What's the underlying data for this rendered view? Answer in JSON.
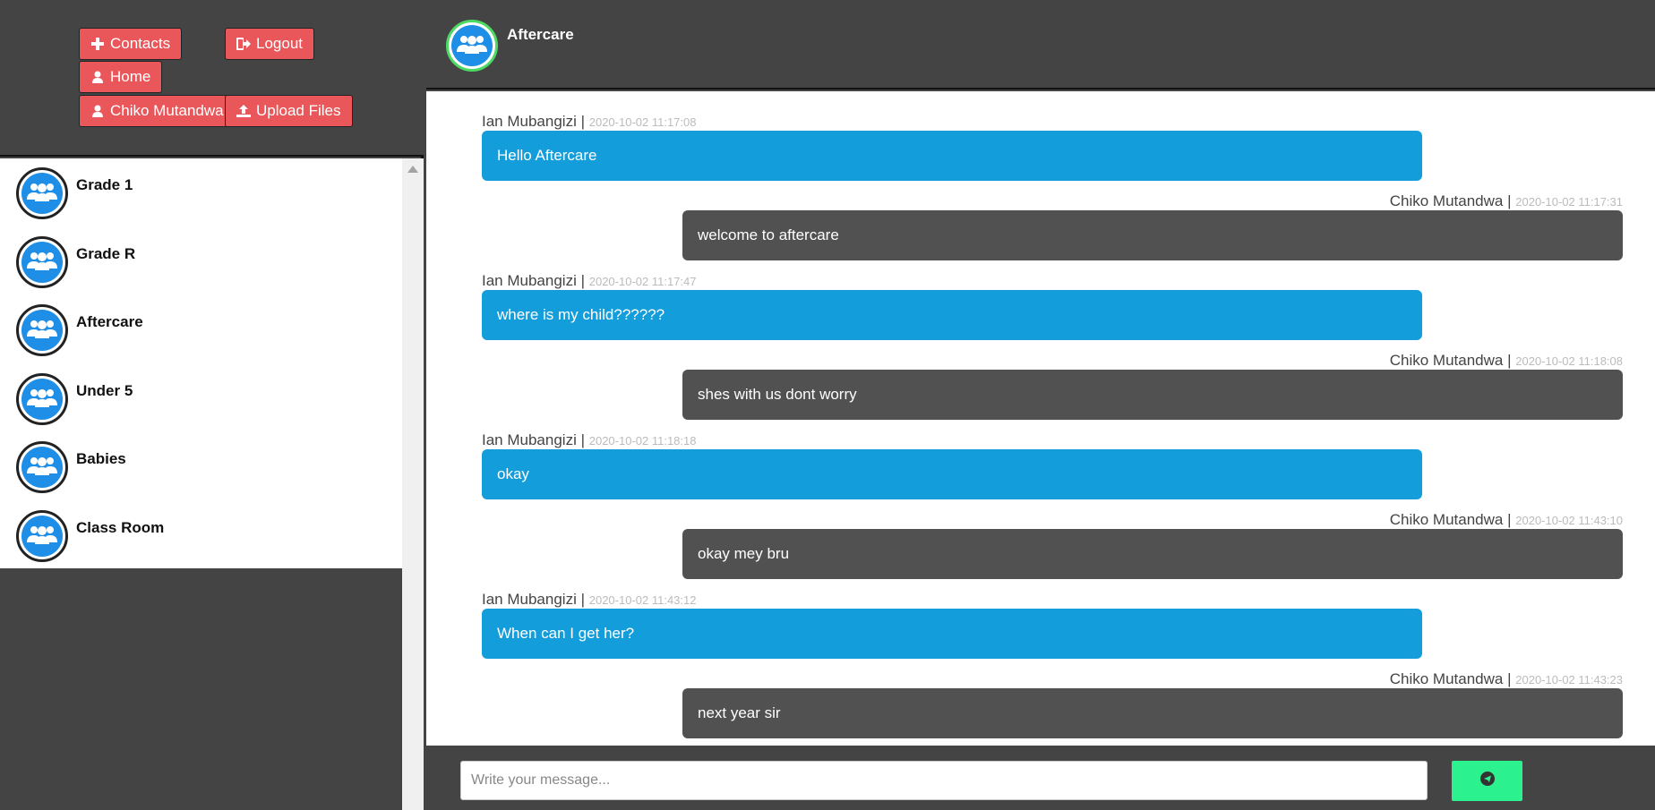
{
  "nav": {
    "contacts_label": "Contacts",
    "logout_label": "Logout",
    "home_label": "Home",
    "user_label": "Chiko Mutandwa",
    "upload_label": "Upload Files"
  },
  "contacts": [
    {
      "name": "Grade 1"
    },
    {
      "name": "Grade R"
    },
    {
      "name": "Aftercare"
    },
    {
      "name": "Under 5"
    },
    {
      "name": "Babies"
    },
    {
      "name": "Class Room"
    }
  ],
  "chat": {
    "title": "Aftercare",
    "messages": [
      {
        "sender": "Ian Mubangizi",
        "sep": "|",
        "time": "2020-10-02 11:17:08",
        "text": "Hello Aftercare",
        "direction": "in"
      },
      {
        "sender": "Chiko Mutandwa",
        "sep": "|",
        "time": "2020-10-02 11:17:31",
        "text": "welcome to aftercare",
        "direction": "out"
      },
      {
        "sender": "Ian Mubangizi",
        "sep": "|",
        "time": "2020-10-02 11:17:47",
        "text": "where is my child??????",
        "direction": "in"
      },
      {
        "sender": "Chiko Mutandwa",
        "sep": "|",
        "time": "2020-10-02 11:18:08",
        "text": "shes with us dont worry",
        "direction": "out"
      },
      {
        "sender": "Ian Mubangizi",
        "sep": "|",
        "time": "2020-10-02 11:18:18",
        "text": "okay",
        "direction": "in"
      },
      {
        "sender": "Chiko Mutandwa",
        "sep": "|",
        "time": "2020-10-02 11:43:10",
        "text": "okay mey bru",
        "direction": "out"
      },
      {
        "sender": "Ian Mubangizi",
        "sep": "|",
        "time": "2020-10-02 11:43:12",
        "text": "When can I get her?",
        "direction": "in"
      },
      {
        "sender": "Chiko Mutandwa",
        "sep": "|",
        "time": "2020-10-02 11:43:23",
        "text": "next year sir",
        "direction": "out"
      }
    ]
  },
  "composer": {
    "placeholder": "Write your message...",
    "send_icon": "paper-plane-icon"
  },
  "icons": {
    "contacts": "plus-icon",
    "logout": "sign-out-icon",
    "home": "user-icon",
    "user": "user-icon",
    "upload": "upload-icon",
    "group": "group-icon"
  },
  "colors": {
    "nav_button": "#e9575a",
    "incoming_bubble": "#149ddb",
    "outgoing_bubble": "#525152",
    "send_button": "#2bf28f",
    "avatar_blue": "#1e8ee6",
    "active_ring": "#4cd964"
  }
}
